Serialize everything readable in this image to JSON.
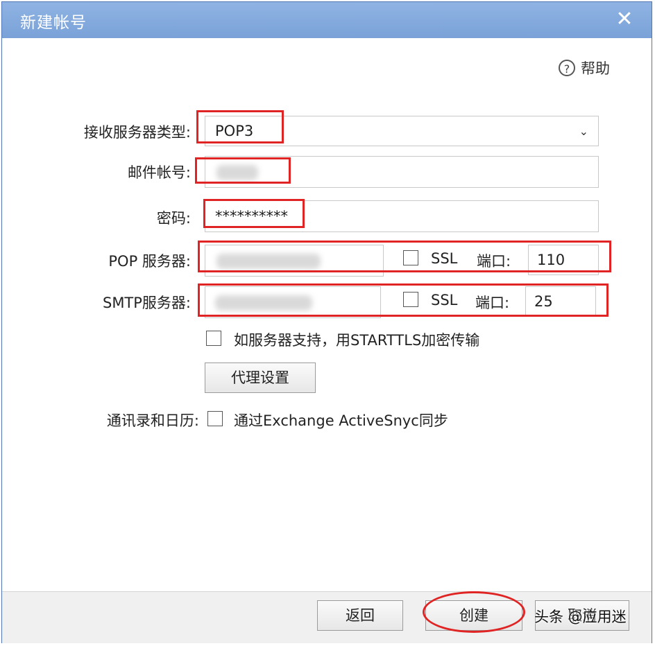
{
  "dialog": {
    "title": "新建帐号",
    "close_icon": "close-icon"
  },
  "help": {
    "label": "帮助",
    "icon": "?"
  },
  "form": {
    "server_type_label": "接收服务器类型:",
    "server_type_value": "POP3",
    "account_label": "邮件帐号:",
    "password_label": "密码:",
    "password_value": "**********",
    "pop_label": "POP 服务器:",
    "pop_ssl_label": "SSL",
    "pop_port_label": "端口:",
    "pop_port_value": "110",
    "smtp_label": "SMTP服务器:",
    "smtp_ssl_label": "SSL",
    "smtp_port_label": "端口:",
    "smtp_port_value": "25",
    "starttls_label": "如服务器支持，用STARTTLS加密传输",
    "proxy_button": "代理设置",
    "contacts_label": "通讯录和日历:",
    "activesync_label": "通过Exchange ActiveSnyc同步"
  },
  "footer": {
    "back_button": "返回",
    "create_button": "创建",
    "cancel_button": "取消"
  },
  "watermark": "头条 @应用迷",
  "colors": {
    "titlebar": "#7aa2d8",
    "annotation": "#e02424"
  }
}
